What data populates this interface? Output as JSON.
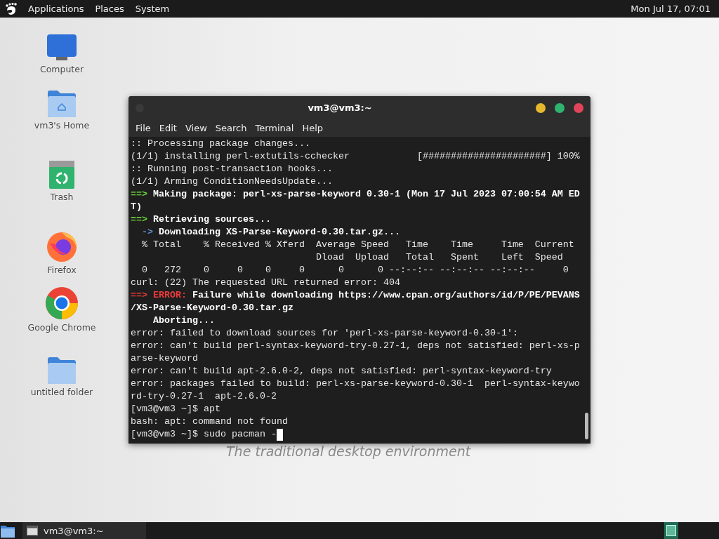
{
  "top_panel": {
    "menus": [
      "Applications",
      "Places",
      "System"
    ],
    "clock": "Mon Jul 17, 07:01"
  },
  "desktop_icons": [
    {
      "label": "Computer",
      "kind": "computer"
    },
    {
      "label": "vm3's Home",
      "kind": "home"
    },
    {
      "label": "Trash",
      "kind": "trash"
    },
    {
      "label": "Firefox",
      "kind": "firefox"
    },
    {
      "label": "Google Chrome",
      "kind": "chrome"
    },
    {
      "label": "untitled folder",
      "kind": "folder"
    }
  ],
  "wallpaper_text": "The traditional desktop environment",
  "terminal": {
    "title": "vm3@vm3:~",
    "menus": [
      "File",
      "Edit",
      "View",
      "Search",
      "Terminal",
      "Help"
    ],
    "cursor": true,
    "lines": [
      [
        {
          "text": ":: Processing package changes...",
          "kind": "plain"
        }
      ],
      [
        {
          "text": "(1/1) installing perl-extutils-cchecker            [######################] 100%",
          "kind": "plain"
        }
      ],
      [
        {
          "text": ":: Running post-transaction hooks...",
          "kind": "plain"
        }
      ],
      [
        {
          "text": "(1/1) Arming ConditionNeedsUpdate...",
          "kind": "plain"
        }
      ],
      [
        {
          "text": "==>",
          "kind": "green"
        },
        {
          "text": " Making package: perl-xs-parse-keyword 0.30-1 (Mon 17 Jul 2023 07:00:54 AM ED",
          "kind": "bold"
        }
      ],
      [
        {
          "text": "T)",
          "kind": "bold"
        }
      ],
      [
        {
          "text": "==>",
          "kind": "green"
        },
        {
          "text": " Retrieving sources...",
          "kind": "bold"
        }
      ],
      [
        {
          "text": "  ->",
          "kind": "blue"
        },
        {
          "text": " Downloading XS-Parse-Keyword-0.30.tar.gz...",
          "kind": "bold"
        }
      ],
      [
        {
          "text": "  % Total    % Received % Xferd  Average Speed   Time    Time     Time  Current",
          "kind": "plain"
        }
      ],
      [
        {
          "text": "                                 Dload  Upload   Total   Spent    Left  Speed",
          "kind": "plain"
        }
      ],
      [
        {
          "text": "  0   272    0     0    0     0      0      0 --:--:-- --:--:-- --:--:--     0",
          "kind": "plain"
        }
      ],
      [
        {
          "text": "curl: (22) The requested URL returned error: 404",
          "kind": "plain"
        }
      ],
      [
        {
          "text": "==> ERROR:",
          "kind": "red"
        },
        {
          "text": " Failure while downloading https://www.cpan.org/authors/id/P/PE/PEVANS",
          "kind": "bold"
        }
      ],
      [
        {
          "text": "/XS-Parse-Keyword-0.30.tar.gz",
          "kind": "bold"
        }
      ],
      [
        {
          "text": "    Aborting...",
          "kind": "bold"
        }
      ],
      [
        {
          "text": "error: failed to download sources for 'perl-xs-parse-keyword-0.30-1':",
          "kind": "plain"
        }
      ],
      [
        {
          "text": "error: can't build perl-syntax-keyword-try-0.27-1, deps not satisfied: perl-xs-p",
          "kind": "plain"
        }
      ],
      [
        {
          "text": "arse-keyword",
          "kind": "plain"
        }
      ],
      [
        {
          "text": "error: can't build apt-2.6.0-2, deps not satisfied: perl-syntax-keyword-try",
          "kind": "plain"
        }
      ],
      [
        {
          "text": "error: packages failed to build: perl-xs-parse-keyword-0.30-1  perl-syntax-keywo",
          "kind": "plain"
        }
      ],
      [
        {
          "text": "rd-try-0.27-1  apt-2.6.0-2",
          "kind": "plain"
        }
      ],
      [
        {
          "text": "[vm3@vm3 ~]$ apt",
          "kind": "plain"
        }
      ],
      [
        {
          "text": "bash: apt: command not found",
          "kind": "plain"
        }
      ],
      [
        {
          "text": "[vm3@vm3 ~]$ sudo pacman -",
          "kind": "plain"
        }
      ]
    ]
  },
  "taskbar": {
    "tasks": [
      {
        "label": "vm3@vm3:~"
      }
    ]
  }
}
